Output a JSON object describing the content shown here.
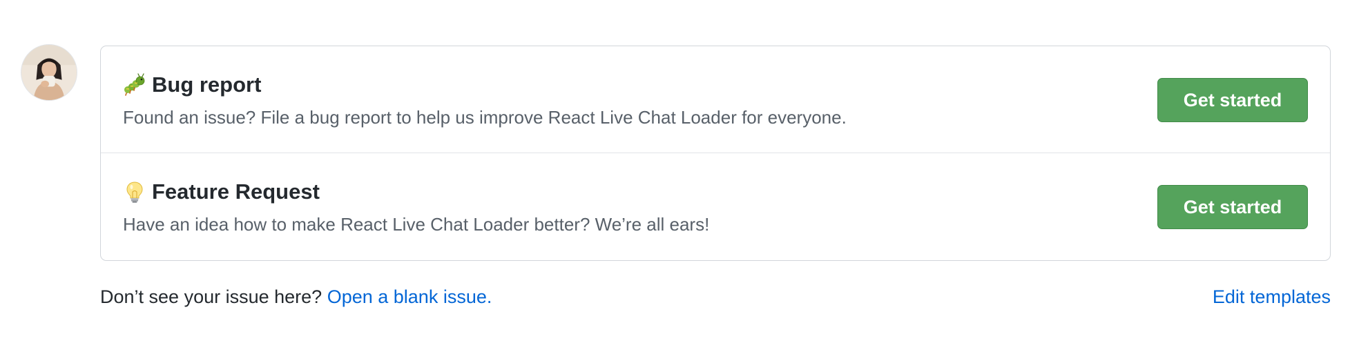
{
  "avatar": {
    "alt": "user avatar"
  },
  "templates": [
    {
      "emoji_icon": "caterpillar-icon",
      "title": "Bug report",
      "description": "Found an issue? File a bug report to help us improve React Live Chat Loader for everyone.",
      "button_label": "Get started"
    },
    {
      "emoji_icon": "lightbulb-icon",
      "title": "Feature Request",
      "description": "Have an idea how to make React Live Chat Loader better? We’re all ears!",
      "button_label": "Get started"
    }
  ],
  "footer": {
    "prompt": "Don’t see your issue here?",
    "blank_issue_link": "Open a blank issue.",
    "edit_templates_link": "Edit templates"
  },
  "colors": {
    "button_green": "#55a35c",
    "link_blue": "#0366d6",
    "border": "#d1d5da"
  }
}
